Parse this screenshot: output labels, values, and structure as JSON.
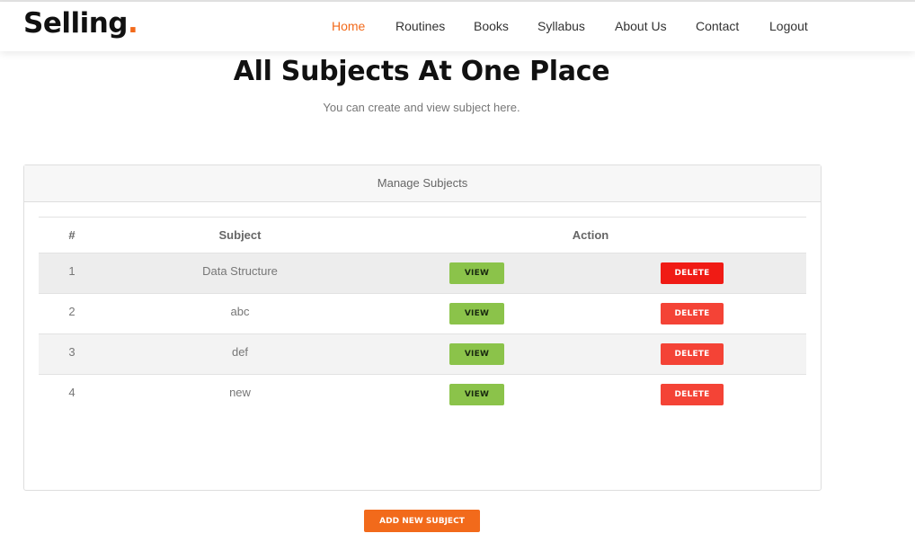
{
  "brand": {
    "name": "Selling",
    "dot": "."
  },
  "nav": [
    {
      "label": "Home",
      "active": true
    },
    {
      "label": "Routines"
    },
    {
      "label": "Books"
    },
    {
      "label": "Syllabus"
    },
    {
      "label": "About Us"
    },
    {
      "label": "Contact"
    },
    {
      "label": "Logout"
    }
  ],
  "hero": {
    "title": "All Subjects At One Place",
    "subtitle": "You can create and view subject here."
  },
  "card": {
    "header": "Manage Subjects",
    "columns": {
      "num": "#",
      "subject": "Subject",
      "action": "Action"
    },
    "rows": [
      {
        "num": "1",
        "subject": "Data Structure",
        "view": "VIEW",
        "delete": "DELETE"
      },
      {
        "num": "2",
        "subject": "abc",
        "view": "VIEW",
        "delete": "DELETE"
      },
      {
        "num": "3",
        "subject": "def",
        "view": "VIEW",
        "delete": "DELETE"
      },
      {
        "num": "4",
        "subject": "new",
        "view": "VIEW",
        "delete": "DELETE"
      }
    ]
  },
  "add_button": "ADD NEW SUBJECT",
  "colors": {
    "accent": "#f26a1b",
    "view_button": "#8bc34a",
    "delete_button": "#f44336"
  }
}
